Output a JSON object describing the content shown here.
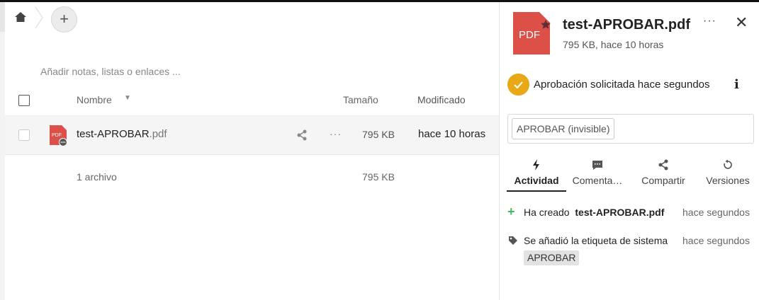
{
  "breadcrumb": {
    "home_icon": "home-icon",
    "add_label": "+"
  },
  "notes_placeholder": "Añadir notas, listas o enlaces ...",
  "table": {
    "columns": {
      "name": "Nombre",
      "size": "Tamaño",
      "modified": "Modificado"
    },
    "rows": [
      {
        "name": "test-APROBAR",
        "ext": ".pdf",
        "icon_label": "PDF",
        "size": "795 KB",
        "modified": "hace 10 horas"
      }
    ],
    "summary": {
      "count": "1 archivo",
      "size": "795 KB"
    }
  },
  "sidebar": {
    "icon_label": "PDF",
    "title": "test-APROBAR.pdf",
    "subtitle": "795 KB, hace 10 horas",
    "more": "···",
    "close": "✕",
    "approval": {
      "text": "Aprobación solicitada hace segundos",
      "info": "i",
      "color": "#e9a816"
    },
    "tag_chip": "APROBAR (invisible)",
    "tabs": [
      {
        "label": "Actividad",
        "icon": "lightning-icon",
        "active": true
      },
      {
        "label": "Comenta…",
        "icon": "comment-icon",
        "active": false
      },
      {
        "label": "Compartir",
        "icon": "share-icon",
        "active": false
      },
      {
        "label": "Versiones",
        "icon": "history-icon",
        "active": false
      }
    ],
    "activity": [
      {
        "icon": "plus-icon",
        "prefix": "Ha creado",
        "subject": "test-APROBAR.pdf",
        "time": "hace segundos"
      },
      {
        "icon": "tag-icon",
        "text": "Se añadió la etiqueta de sistema",
        "time": "hace segundos",
        "tag": "APROBAR"
      }
    ]
  },
  "colors": {
    "pdf_red": "#dc5047",
    "approval_yellow": "#e9a816",
    "added_green": "#46ba61"
  }
}
